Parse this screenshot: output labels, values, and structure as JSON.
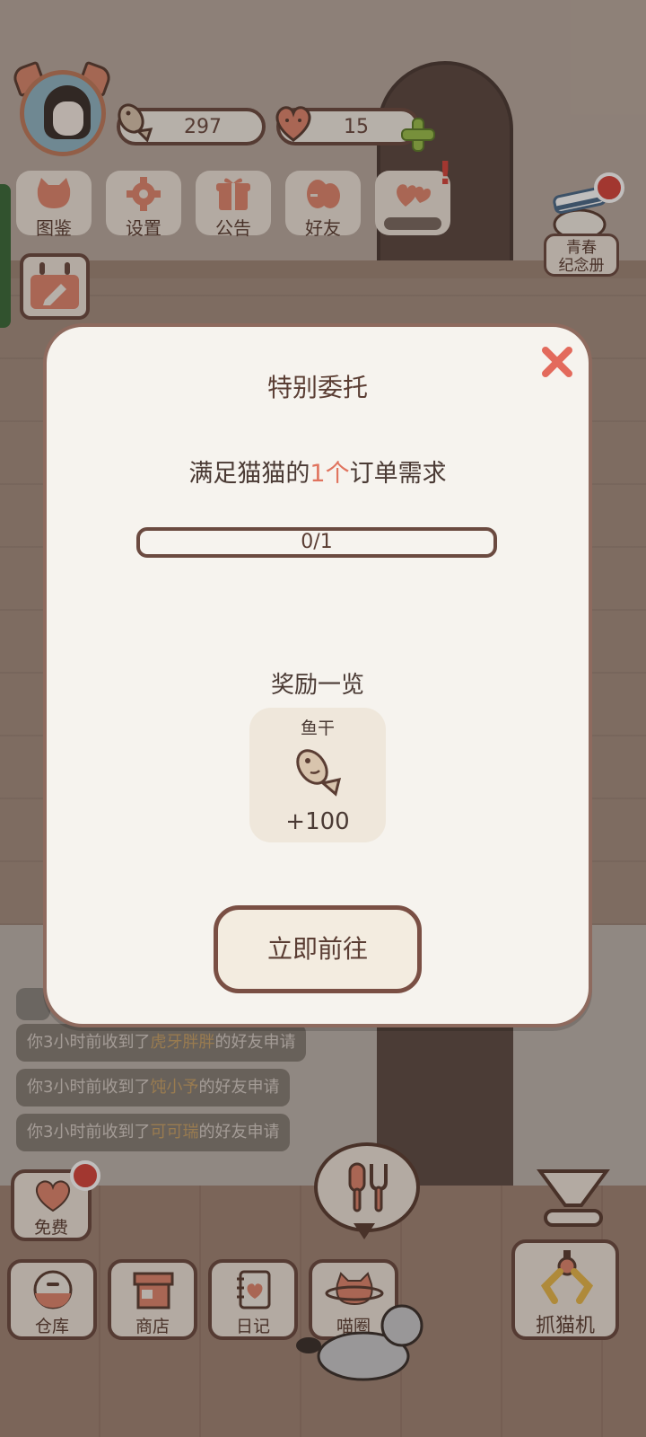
{
  "hud": {
    "fish_count": "297",
    "heart_count": "15"
  },
  "menu": [
    {
      "label": "图鉴",
      "icon": "cat-head-icon"
    },
    {
      "label": "设置",
      "icon": "gear-icon"
    },
    {
      "label": "公告",
      "icon": "gift-icon"
    },
    {
      "label": "好友",
      "icon": "friends-icon"
    },
    {
      "label": "",
      "icon": "heart-pair-icon"
    }
  ],
  "youth_album": {
    "label": "青春\n纪念册"
  },
  "chat": [
    {
      "prefix": "你3小时前收到了",
      "name": "虎牙胖胖",
      "suffix": "的好友申请"
    },
    {
      "prefix": "你3小时前收到了",
      "name": "饨小予",
      "suffix": "的好友申请"
    },
    {
      "prefix": "你3小时前收到了",
      "name": "可可瑞",
      "suffix": "的好友申请"
    }
  ],
  "bottom": {
    "free": "免费",
    "warehouse": "仓库",
    "shop": "商店",
    "diary": "日记",
    "circle": "喵圈",
    "claw": "抓猫机"
  },
  "modal": {
    "title": "特别委托",
    "desc_prefix": "满足猫猫的",
    "desc_num": "1个",
    "desc_suffix": "订单需求",
    "progress_text": "0/1",
    "progress_value": 0,
    "reward_title": "奖励一览",
    "reward": {
      "name": "鱼干",
      "icon": "dried-fish-icon",
      "amount": "+100"
    },
    "go_label": "立即前往"
  },
  "colors": {
    "accent": "#e0735e",
    "border": "#6b4a40",
    "panel": "#f6f3ee",
    "badge": "#d6443c"
  }
}
